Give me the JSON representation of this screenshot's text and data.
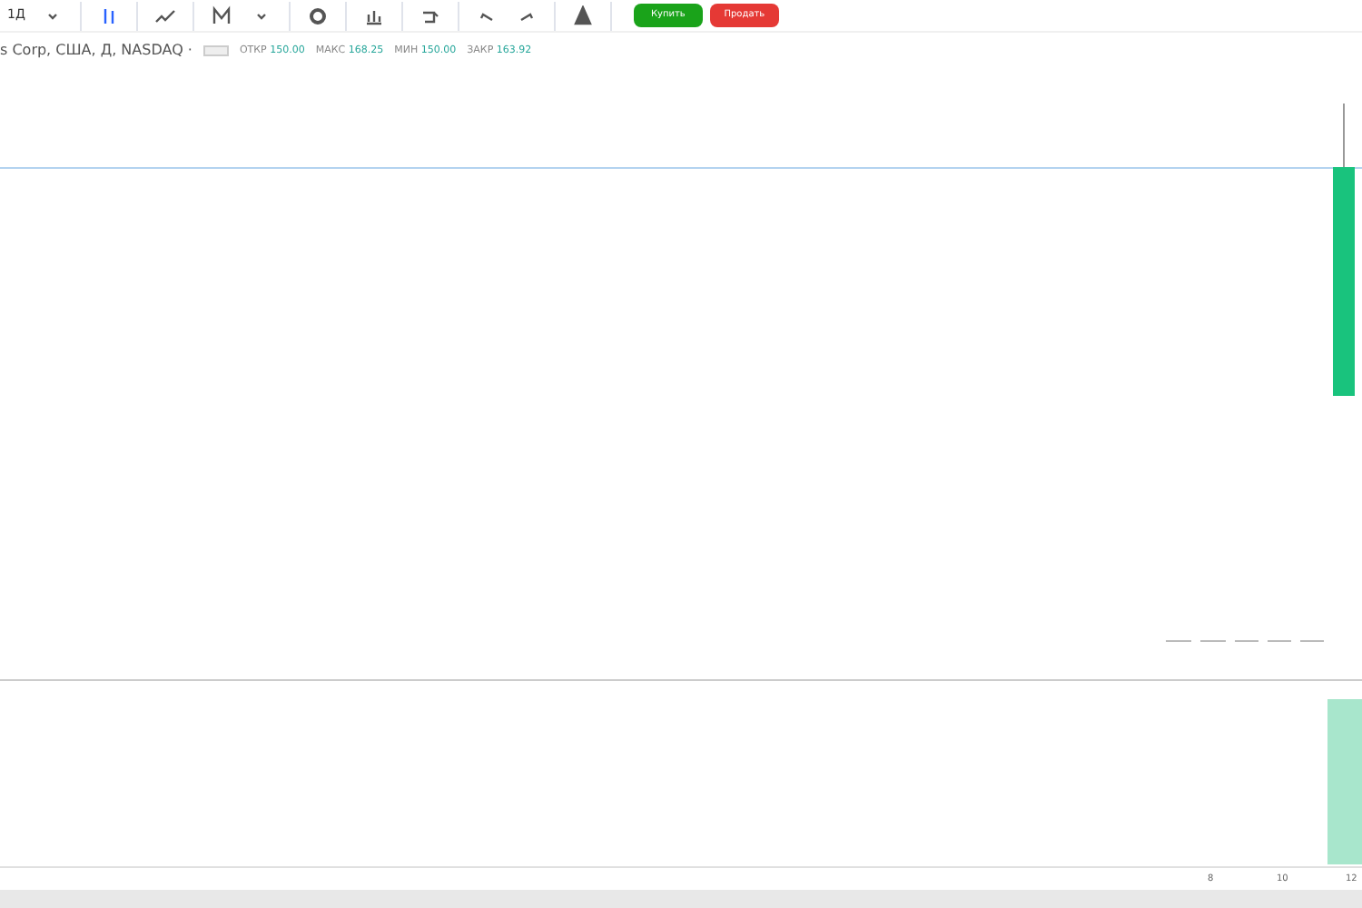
{
  "toolbar": {
    "interval": "1Д",
    "buy_button": "Купить",
    "sell_button": "Продать"
  },
  "legend": {
    "symbol": "s Corp, США, Д, NASDAQ ·",
    "values": [
      {
        "label": "ОТКР",
        "value": "150.00"
      },
      {
        "label": "МАКС",
        "value": "168.25"
      },
      {
        "label": "МИН",
        "value": "150.00"
      },
      {
        "label": "ЗАКР",
        "value": "163.92"
      }
    ]
  },
  "time_axis": {
    "labels": [
      "8",
      "10",
      "12"
    ]
  }
}
